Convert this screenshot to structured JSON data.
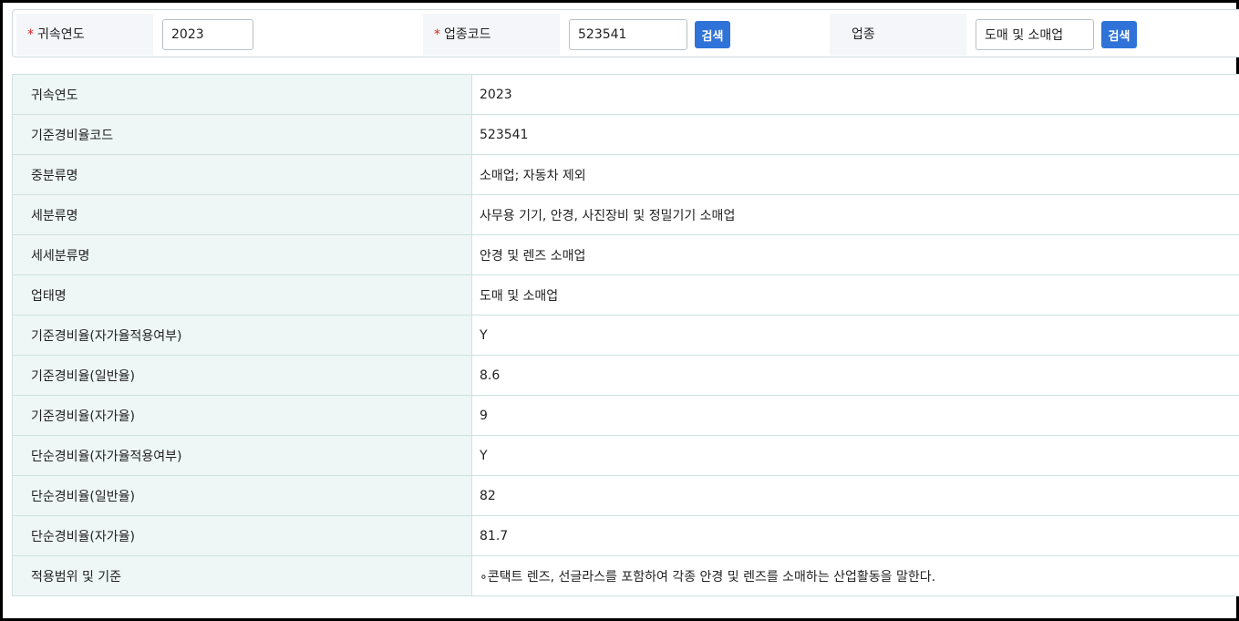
{
  "search": {
    "year_label": "귀속연도",
    "year_value": "2023",
    "code_label": "업종코드",
    "code_value": "523541",
    "code_search_button": "검색",
    "industry_label": "업종",
    "industry_value": "도매 및 소매업",
    "industry_search_button": "검색",
    "required_mark": "*"
  },
  "details": [
    {
      "label": "귀속연도",
      "value": "2023"
    },
    {
      "label": "기준경비율코드",
      "value": "523541"
    },
    {
      "label": "중분류명",
      "value": "소매업; 자동차 제외"
    },
    {
      "label": "세분류명",
      "value": "사무용 기기, 안경, 사진장비 및 정밀기기 소매업"
    },
    {
      "label": "세세분류명",
      "value": "안경 및 렌즈 소매업"
    },
    {
      "label": "업태명",
      "value": "도매 및 소매업"
    },
    {
      "label": "기준경비율(자가율적용여부)",
      "value": "Y"
    },
    {
      "label": "기준경비율(일반율)",
      "value": "8.6"
    },
    {
      "label": "기준경비율(자가율)",
      "value": "9"
    },
    {
      "label": "단순경비율(자가율적용여부)",
      "value": "Y"
    },
    {
      "label": "단순경비율(일반율)",
      "value": "82"
    },
    {
      "label": "단순경비율(자가율)",
      "value": "81.7"
    },
    {
      "label": "적용범위 및 기준",
      "value": "∘콘택트 렌즈, 선글라스를 포함하여 각종 안경 및 렌즈를 소매하는 산업활동을 말한다."
    }
  ],
  "colors": {
    "accent": "#2f73d9",
    "required": "#e02020",
    "label_bg": "#eef7f6"
  }
}
